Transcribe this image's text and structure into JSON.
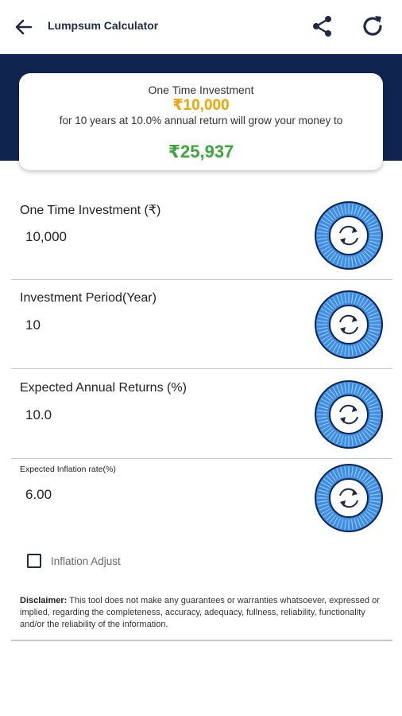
{
  "appbar": {
    "title": "Lumpsum Calculator"
  },
  "summary": {
    "line1": "One Time Investment",
    "amount": "₹10,000",
    "line2": "for 10 years at 10.0% annual return will grow your money to",
    "result": "₹25,937"
  },
  "fields": [
    {
      "label": "One Time Investment (₹)",
      "value": "10,000"
    },
    {
      "label": "Investment Period(Year)",
      "value": "10"
    },
    {
      "label": "Expected Annual Returns (%)",
      "value": "10.0"
    },
    {
      "label": "Expected Inflation rate(%)",
      "value": "6.00"
    }
  ],
  "inflation_adjust": {
    "label": "Inflation Adjust",
    "checked": false
  },
  "disclaimer": {
    "title": "Disclaimer:",
    "text": " This tool does not make any guarantees or warranties whatsoever, expressed or implied, regarding the completeness, accuracy, adequacy, fullness, reliability, functionality and/or the reliability of the information."
  },
  "colors": {
    "header_band": "#0f2550",
    "amount": "#f2a400",
    "result": "#3aa83a",
    "dial": "#3d8fe6"
  },
  "icons": [
    "back-arrow-icon",
    "share-icon",
    "refresh-icon",
    "rotate-icon"
  ]
}
